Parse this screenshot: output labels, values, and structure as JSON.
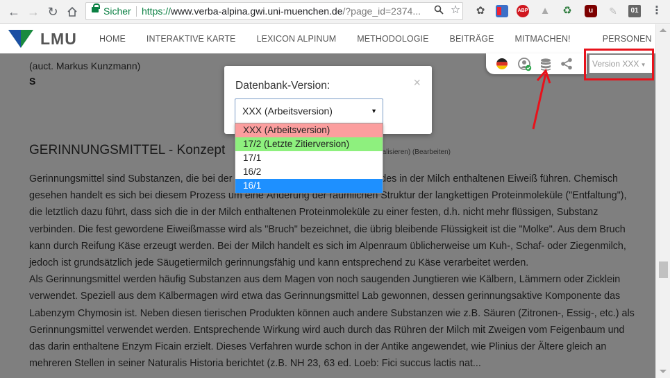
{
  "browser": {
    "secure_label": "Sicher",
    "url_scheme": "https://",
    "url_host": "www.verba-alpina.gwi.uni-muenchen.de",
    "url_rest": "/?page_id=2374...",
    "ext_abp": "ABP",
    "ext_ublock": "u",
    "ext_badge": "01"
  },
  "site": {
    "logo_text": "LMU",
    "nav": [
      "HOME",
      "INTERAKTIVE KARTE",
      "LEXICON ALPINUM",
      "METHODOLOGIE",
      "BEITRÄGE",
      "MITMACHEN!",
      "PERSONEN"
    ]
  },
  "page": {
    "author": "(auct. Markus Kunzmann)",
    "letter": "S",
    "title": "GERINNUNGSMITTEL - Konzept",
    "actions": "(Visualisieren)  (Bearbeiten)",
    "paragraph": "Gerinnungsmittel sind Substanzen, die bei der Käseherstellung zur Koagulation des in der Milch enthaltenen Eiweiß führen. Chemisch gesehen handelt es sich bei diesem Prozess um eine Änderung der räumlichen Struktur der langkettigen Proteinmoleküle (\"Entfaltung\"), die letztlich dazu führt, dass sich die in der Milch enthaltenen Proteinmoleküle zu einer festen, d.h. nicht mehr flüssigen, Substanz verbinden. Die fest gewordene Eiweißmasse wird als \"Bruch\" bezeichnet, die übrig bleibende Flüssigkeit ist die \"Molke\". Aus dem Bruch kann durch Reifung Käse erzeugt werden. Bei der Milch handelt es sich im Alpenraum üblicherweise um Kuh-, Schaf- oder Ziegenmilch, jedoch ist grundsätzlich jede Säugetiermilch gerinnungsfähig und kann entsprechend zu Käse verarbeitet werden.",
    "paragraph2": "Als Gerinnungsmittel werden häufig Substanzen aus dem Magen von noch saugenden Jungtieren wie Kälbern, Lämmern oder Zicklein verwendet. Speziell aus dem Kälbermagen wird etwa das Gerinnungsmittel Lab gewonnen, dessen gerinnungsaktive Komponente das Labenzym Chymosin ist. Neben diesen tierischen Produkten können auch andere Substanzen wie z.B. Säuren (Zitronen-, Essig-, etc.) als Gerinnungsmittel verwendet werden. Entsprechende Wirkung wird auch durch das Rühren der Milch mit Zweigen vom Feigenbaum und das darin enthaltene Enzym Ficain erzielt. Dieses Verfahren wurde schon in der Antike angewendet, wie Plinius der Ältere gleich an mehreren Stellen in seiner Naturalis Historia berichtet (z.B. NH 23, 63 ed. Loeb: Fici succus lactis nat...",
    "version_label": "Version XXX"
  },
  "modal": {
    "title": "Datenbank-Version:",
    "close": "×",
    "selected": "XXX (Arbeitsversion)",
    "options": [
      {
        "label": "XXX (Arbeitsversion)",
        "color": "#fb9e9e"
      },
      {
        "label": "17/2 (Letzte Zitierversion)",
        "color": "#8ef07e"
      },
      {
        "label": "17/1",
        "color": "#ffffff"
      },
      {
        "label": "16/2",
        "color": "#ffffff"
      },
      {
        "label": "16/1",
        "color": "#1e90ff"
      }
    ]
  }
}
